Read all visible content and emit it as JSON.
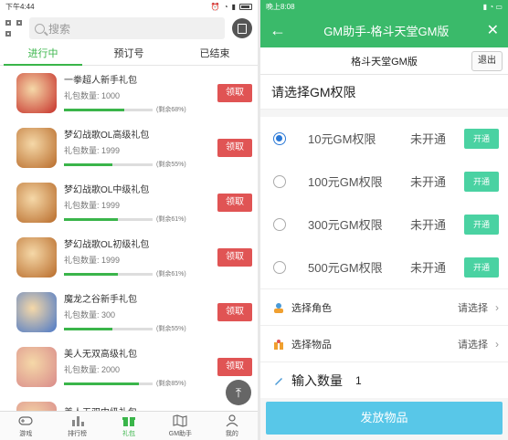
{
  "left": {
    "status_time": "下午4:44",
    "search_placeholder": "搜索",
    "tabs": [
      "进行中",
      "预订号",
      "已结束"
    ],
    "count_prefix": "礼包数量: ",
    "get_label": "领取",
    "gifts": [
      {
        "title": "一拳超人新手礼包",
        "count": "1000",
        "remain": "(剩余68%)",
        "pct": 0.68,
        "color": "#c6302a"
      },
      {
        "title": "梦幻战歌OL高级礼包",
        "count": "1999",
        "remain": "(剩余55%)",
        "pct": 0.55,
        "color": "#b86b2a"
      },
      {
        "title": "梦幻战歌OL中级礼包",
        "count": "1999",
        "remain": "(剩余61%)",
        "pct": 0.61,
        "color": "#b86b2a"
      },
      {
        "title": "梦幻战歌OL初级礼包",
        "count": "1999",
        "remain": "(剩余61%)",
        "pct": 0.61,
        "color": "#b86b2a"
      },
      {
        "title": "魔龙之谷新手礼包",
        "count": "300",
        "remain": "(剩余55%)",
        "pct": 0.55,
        "color": "#4a78c8"
      },
      {
        "title": "美人无双高级礼包",
        "count": "2000",
        "remain": "(剩余85%)",
        "pct": 0.85,
        "color": "#d98a8a"
      },
      {
        "title": "美人无双中级礼包",
        "count": "",
        "remain": "",
        "pct": 0.8,
        "color": "#d98a8a"
      }
    ],
    "nav": [
      "游戏",
      "排行榜",
      "礼包",
      "GM助手",
      "我的"
    ]
  },
  "right": {
    "status_time": "晚上8:08",
    "header_title": "GM助手-格斗天堂GM版",
    "sub_title": "格斗天堂GM版",
    "exit_label": "退出",
    "section_title": "请选择GM权限",
    "perms": [
      {
        "name": "10元GM权限",
        "status": "未开通",
        "btn": "开通",
        "checked": true
      },
      {
        "name": "100元GM权限",
        "status": "未开通",
        "btn": "开通",
        "checked": false
      },
      {
        "name": "300元GM权限",
        "status": "未开通",
        "btn": "开通",
        "checked": false
      },
      {
        "name": "500元GM权限",
        "status": "未开通",
        "btn": "开通",
        "checked": false
      }
    ],
    "select_role_label": "选择角色",
    "select_item_label": "选择物品",
    "select_placeholder": "请选择",
    "qty_label": "输入数量",
    "qty_value": "1",
    "send_label": "发放物品"
  }
}
